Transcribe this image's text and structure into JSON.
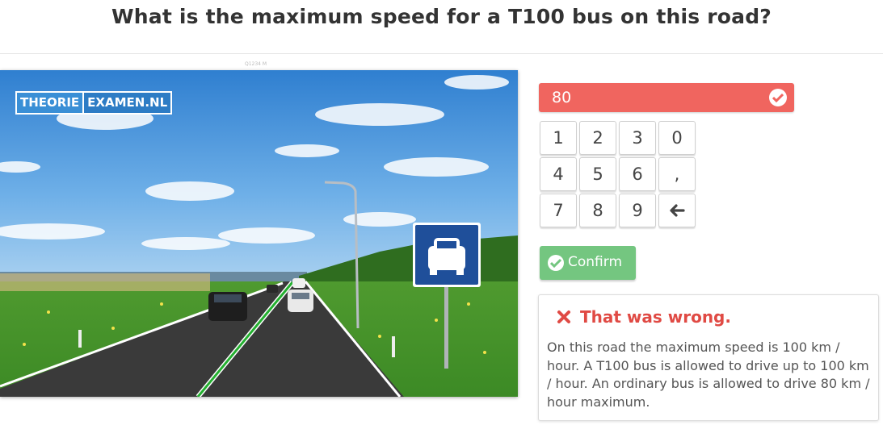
{
  "question": "What is the maximum speed for a T100 bus on this road?",
  "image_label": "Q1234 M",
  "logo": {
    "part1": "THEORIE",
    "part2": "EXAMEN.NL"
  },
  "answer": {
    "value": "80",
    "status_icon": "check-circle-icon"
  },
  "keypad": {
    "keys": [
      "1",
      "2",
      "3",
      "0",
      "4",
      "5",
      "6",
      ",",
      "7",
      "8",
      "9"
    ],
    "backspace_icon": "arrow-left-icon"
  },
  "confirm": {
    "label": "Confirm",
    "icon": "check-circle-icon"
  },
  "feedback": {
    "icon": "x-mark-icon",
    "title": "That was wrong.",
    "text": "On this road the maximum speed is 100 km / hour. A T100 bus is allowed to drive up to 100 km / hour. An ordinary bus is allowed to drive 80 km / hour maximum."
  },
  "colors": {
    "answer_wrong": "#f0655f",
    "confirm_green": "#74c680",
    "error_red": "#e04a44",
    "sign_blue": "#1f4f9a"
  }
}
